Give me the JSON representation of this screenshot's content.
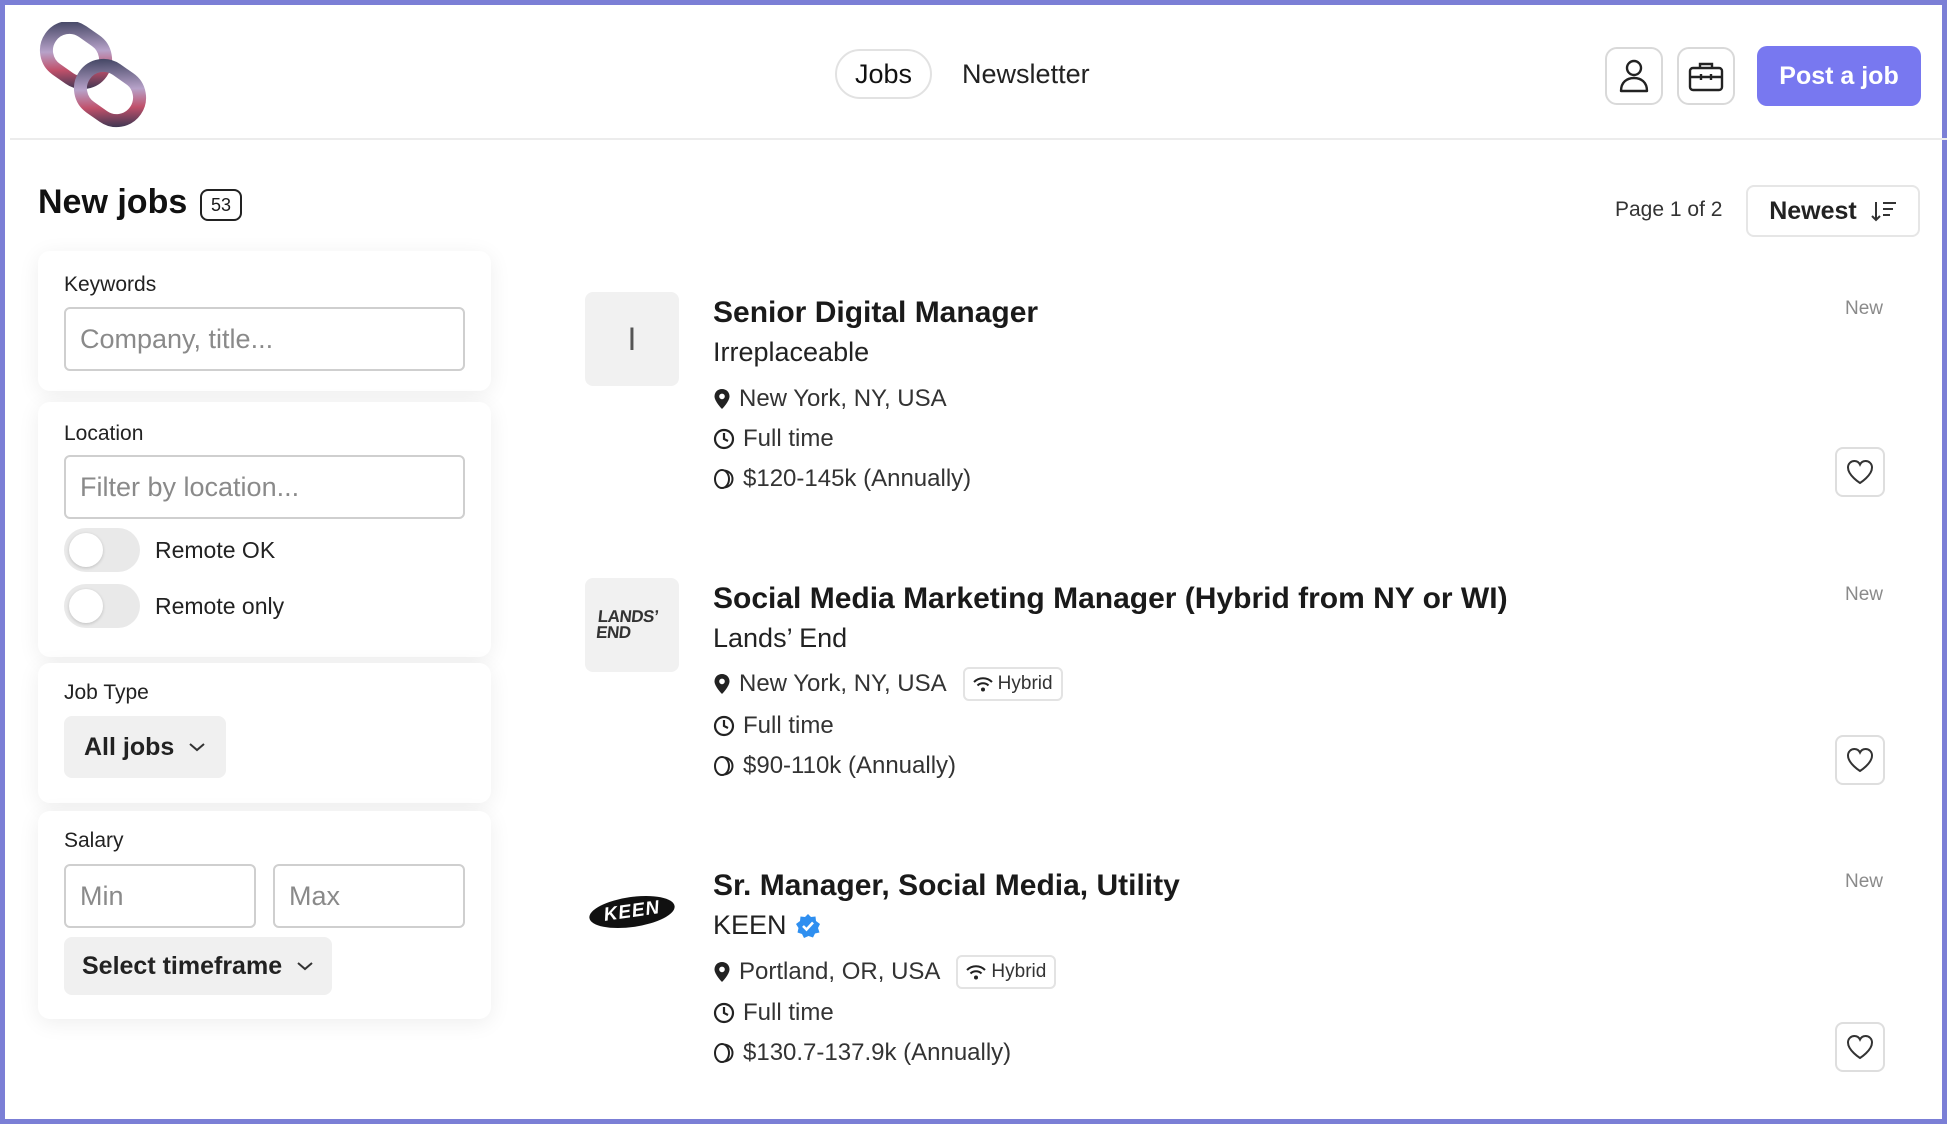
{
  "header": {
    "nav": [
      {
        "label": "Jobs",
        "active": true
      },
      {
        "label": "Newsletter",
        "active": false
      }
    ],
    "post_job_label": "Post a job",
    "icons": [
      "user-icon",
      "briefcase-icon"
    ],
    "accent_color": "#7878f0"
  },
  "listing": {
    "title": "New jobs",
    "count": "53",
    "page_info": "Page 1 of 2",
    "sort_label": "Newest"
  },
  "filters": {
    "keywords": {
      "label": "Keywords",
      "placeholder": "Company, title..."
    },
    "location": {
      "label": "Location",
      "placeholder": "Filter by location...",
      "remote_ok_label": "Remote OK",
      "remote_only_label": "Remote only"
    },
    "job_type": {
      "label": "Job Type",
      "selected": "All jobs"
    },
    "salary": {
      "label": "Salary",
      "min_placeholder": "Min",
      "max_placeholder": "Max",
      "timeframe_label": "Select timeframe"
    }
  },
  "jobs": [
    {
      "title": "Senior Digital Manager",
      "company": "Irreplaceable",
      "logo_text": "I",
      "location": "New York, NY, USA",
      "type": "Full time",
      "salary": "$120-145k (Annually)",
      "tag": "New"
    },
    {
      "title": "Social Media Marketing Manager (Hybrid from NY or WI)",
      "company": "Lands’ End",
      "logo_text": "LANDS’ END",
      "location": "New York, NY, USA",
      "hybrid_label": "Hybrid",
      "type": "Full time",
      "salary": "$90-110k (Annually)",
      "tag": "New"
    },
    {
      "title": "Sr. Manager, Social Media, Utility",
      "company": "KEEN",
      "logo_text": "KEEN",
      "verified": true,
      "location": "Portland, OR, USA",
      "hybrid_label": "Hybrid",
      "type": "Full time",
      "salary": "$130.7-137.9k (Annually)",
      "tag": "New"
    }
  ]
}
